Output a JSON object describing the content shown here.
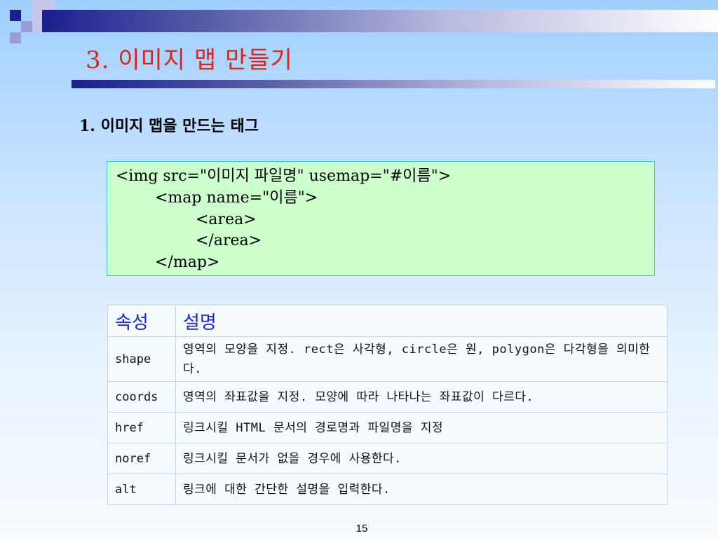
{
  "title": "3. 이미지 맵 만들기",
  "subtitle": "1. 이미지 맵을 만드는 태그",
  "code_lines": [
    "<img src=\"이미지 파일명\" usemap=\"#이름\">",
    "<map name=\"이름\">",
    "<area>",
    "</area>",
    "</map>"
  ],
  "table": {
    "headers": [
      "속성",
      "설명"
    ],
    "rows": [
      {
        "attr": "shape",
        "desc": "영역의 모양을 지정. rect은 사각형, circle은 원, polygon은 다각형을 의미한다."
      },
      {
        "attr": "coords",
        "desc": "영역의 좌표값을 지정. 모양에 따라 나타나는 좌표값이 다르다."
      },
      {
        "attr": "href",
        "desc": "링크시킬 HTML 문서의 경로명과 파일명을 지정"
      },
      {
        "attr": "noref",
        "desc": "링크시킬 문서가 없을 경우에 사용한다."
      },
      {
        "attr": "alt",
        "desc": "링크에 대한 간단한 설명을 입력한다."
      }
    ]
  },
  "page_number": "15",
  "colors": {
    "title": "#e3211b",
    "header_text": "#1c24d8",
    "code_bg": "#ccffcc",
    "accent_navy": "#1b1f8f"
  }
}
